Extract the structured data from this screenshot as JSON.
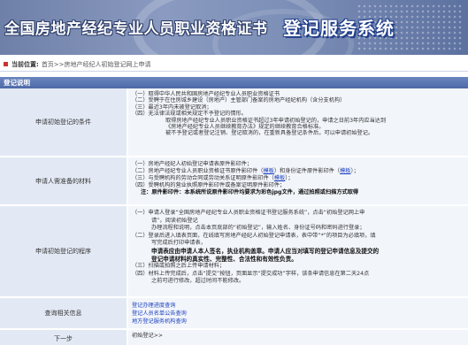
{
  "banner": {
    "title": "全国房地产经纪专业人员职业资格证书",
    "subtitle": "登记服务系统"
  },
  "breadcrumb": {
    "label": "当前位置:",
    "path": "首页>>房地产经纪人初始登记网上申请"
  },
  "section_title": "登记说明",
  "rows": {
    "conditions": {
      "label": "申请初始登记的条件",
      "lines": [
        "（一）取得中华人民共和国房地产经纪专业人员职业资格证书",
        "（二）受聘于在住房城乡建设（房地产）主管部门备案的房地产经纪机构（含分支机构）",
        "（三）最近3年内未被登记取消；",
        "（四）无法律法规或相关规定不予登记的情形。",
        "取得房地产经纪专业人员职业资格证书超过3年申请初始登记的，申请之日前3年内应当达到",
        "《房地产经纪专业人员继续教育办法》规定的继续教育合格标准。",
        "被不予登记或者登记注销、登记取消的，在重新具备登记条件后，可以申请初始登记。"
      ]
    },
    "materials": {
      "label": "申请人需准备的材料",
      "line1": "（一）房地产经纪人初始登记申请表原件影印件；",
      "line2_pre": "（二）房地产经纪专业人员职业资格证书原件影印件（",
      "line2_link": "模板",
      "line2_mid": "）和身份证件原件影印件（",
      "line2_link2": "模板",
      "line2_post": "）；",
      "line3_pre": "（三）与受聘机构的劳动合同或劳动关系证明原件影印件（",
      "line3_link": "模板",
      "line3_post": "）；",
      "line4": "（四）受聘机构的营业执照原件影印件或备案证明原件影印件；",
      "note": "注：原件影印件：本系统所说原件影印件均要求为彩色jpg文件，通过拍照或扫描方式取得"
    },
    "procedure": {
      "label": "申请初始登记的程序",
      "l1": "（一）申请人登录“全国房地产经纪专业人员职业资格证书登记服务系统”，点击“初始登记网上申",
      "l2": "请”，阅读初始登记",
      "l3": "办理流程和说明，点击本页底部的“初始登记”，输入姓名、身份证号码和密码进行登录；",
      "l4": "（二）登录后进入填表页面，在线填写房地产经纪人初始登记申请表，表中带“*”的项目为必填项，填",
      "l5": "写完成后打印申请表，",
      "l6": "申请表应由申请人本人签名，执业机构盖章。申请人应当对填写的登记申请信息及提交的",
      "l7": "登记申请材料的真实性、完整性、合法性和有效性负责。",
      "l8": "（三）扫描或拍照之后上传申请材料；",
      "l9": "（四）材料上传完成后，点击“提交”按钮，页面显示“提交成功”字样，该条申请信息在第二天24点",
      "l10": "之前可进行修改，超过时间不能修改。"
    },
    "query": {
      "label": "查询相关信息",
      "links": [
        "登记办理进度查询",
        "登记人员名单公告查询",
        "地方登记服务机构查询"
      ]
    },
    "next": {
      "label": "下一步",
      "link": "初始登记>>"
    }
  }
}
